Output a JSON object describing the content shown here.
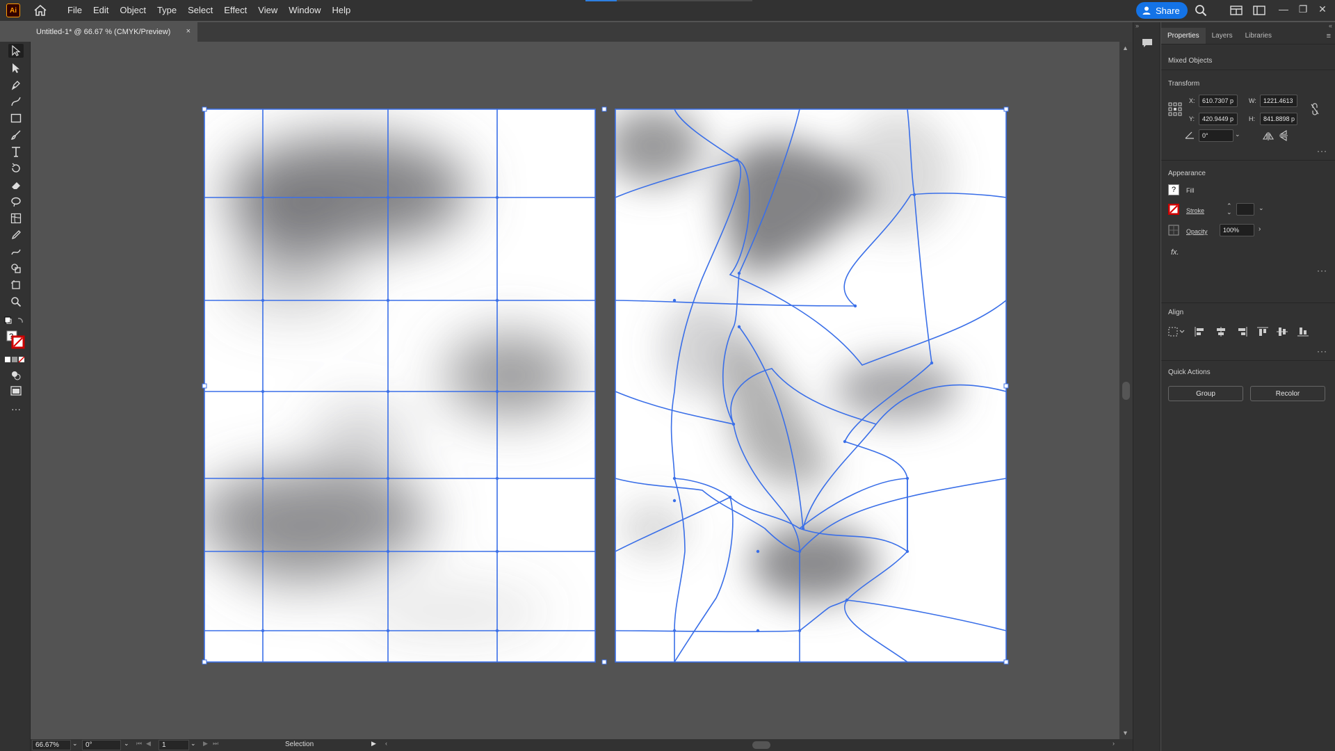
{
  "app": {
    "logo_text": "Ai"
  },
  "menu": [
    "File",
    "Edit",
    "Object",
    "Type",
    "Select",
    "Effect",
    "View",
    "Window",
    "Help"
  ],
  "share": {
    "label": "Share"
  },
  "document_tab": {
    "title": "Untitled-1* @ 66.67 % (CMYK/Preview)",
    "close": "×"
  },
  "panel": {
    "tabs": [
      "Properties",
      "Layers",
      "Libraries"
    ],
    "selection_type": "Mixed Objects",
    "transform": {
      "heading": "Transform",
      "x_label": "X:",
      "x_value": "610.7307 p",
      "y_label": "Y:",
      "y_value": "420.9449 p",
      "w_label": "W:",
      "w_value": "1221.4613",
      "h_label": "H:",
      "h_value": "841.8898 p",
      "angle_value": "0°"
    },
    "appearance": {
      "heading": "Appearance",
      "fill_label": "Fill",
      "fill_icon": "?",
      "stroke_label": "Stroke",
      "opacity_label": "Opacity",
      "opacity_value": "100%",
      "fx": "fx."
    },
    "align": {
      "heading": "Align"
    },
    "quick_actions": {
      "heading": "Quick Actions",
      "group_label": "Group",
      "recolor_label": "Recolor"
    }
  },
  "statusbar": {
    "zoom": "66.67%",
    "rotation": "0°",
    "artboard": "1",
    "tool": "Selection"
  },
  "colors": {
    "accent": "#1473e6",
    "mesh": "#3a6fe8",
    "ui_dark": "#323232",
    "canvas": "#535353"
  }
}
